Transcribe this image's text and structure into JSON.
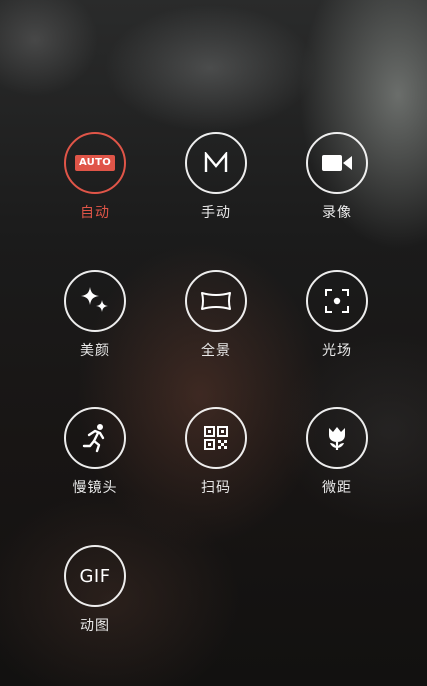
{
  "camera_modes": [
    {
      "id": "auto",
      "label": "自动",
      "icon": "auto-icon",
      "icon_text": "AUTO",
      "active": true
    },
    {
      "id": "manual",
      "label": "手动",
      "icon": "manual-m-icon",
      "active": false
    },
    {
      "id": "video",
      "label": "录像",
      "icon": "video-camera-icon",
      "active": false
    },
    {
      "id": "beauty",
      "label": "美颜",
      "icon": "sparkle-icon",
      "active": false
    },
    {
      "id": "panorama",
      "label": "全景",
      "icon": "panorama-icon",
      "active": false
    },
    {
      "id": "light-field",
      "label": "光场",
      "icon": "focus-frame-icon",
      "active": false
    },
    {
      "id": "slow-motion",
      "label": "慢镜头",
      "icon": "running-person-icon",
      "active": false
    },
    {
      "id": "scan",
      "label": "扫码",
      "icon": "qr-code-icon",
      "active": false
    },
    {
      "id": "macro",
      "label": "微距",
      "icon": "flower-icon",
      "active": false
    },
    {
      "id": "gif",
      "label": "动图",
      "icon": "gif-icon",
      "icon_text": "GIF",
      "active": false
    }
  ],
  "colors": {
    "active": "#e05548",
    "ring": "#ffffff",
    "label": "#e9e9e9"
  }
}
